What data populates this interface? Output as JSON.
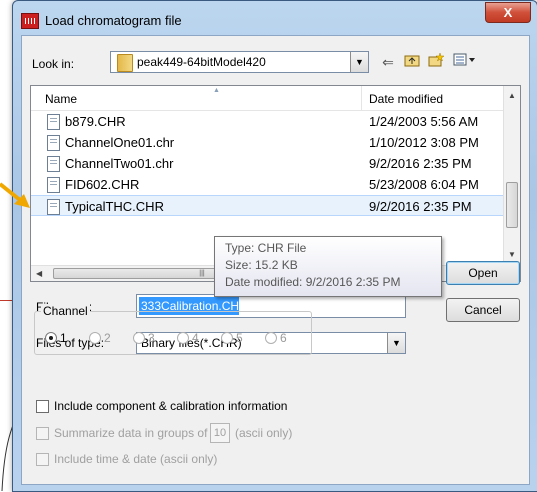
{
  "window": {
    "title": "Load chromatogram file",
    "close_label": "X"
  },
  "look_in": {
    "label": "Look in:",
    "value": "peak449-64bitModel420"
  },
  "columns": {
    "name": "Name",
    "date": "Date modified"
  },
  "files": [
    {
      "name": "b879.CHR",
      "date": "1/24/2003 5:56 AM"
    },
    {
      "name": "ChannelOne01.chr",
      "date": "1/10/2012 3:08 PM"
    },
    {
      "name": "ChannelTwo01.chr",
      "date": "9/2/2016 2:35 PM"
    },
    {
      "name": "FID602.CHR",
      "date": "5/23/2008 6:04 PM"
    },
    {
      "name": "TypicalTHC.CHR",
      "date": "9/2/2016 2:35 PM"
    }
  ],
  "tooltip": {
    "type": "Type: CHR File",
    "size": "Size: 15.2 KB",
    "modified": "Date modified: 9/2/2016 2:35 PM"
  },
  "file_name": {
    "label": "File name:",
    "value": "333Calibration.CHR"
  },
  "file_type": {
    "label": "Files of type:",
    "value": "Binary files(*.CHR)"
  },
  "buttons": {
    "open": "Open",
    "cancel": "Cancel"
  },
  "channel": {
    "label": "Channel",
    "options": [
      "1",
      "2",
      "3",
      "4",
      "5",
      "6"
    ],
    "selected": "1"
  },
  "options": {
    "include_component": "Include component & calibration information",
    "summarize_prefix": "Summarize data in groups of",
    "summarize_value": "10",
    "summarize_suffix": "(ascii only)",
    "include_time": "Include time & date (ascii only)"
  },
  "colors": {
    "accent": "#3399ff",
    "close": "#c13a23",
    "pointer": "#f0a800"
  }
}
